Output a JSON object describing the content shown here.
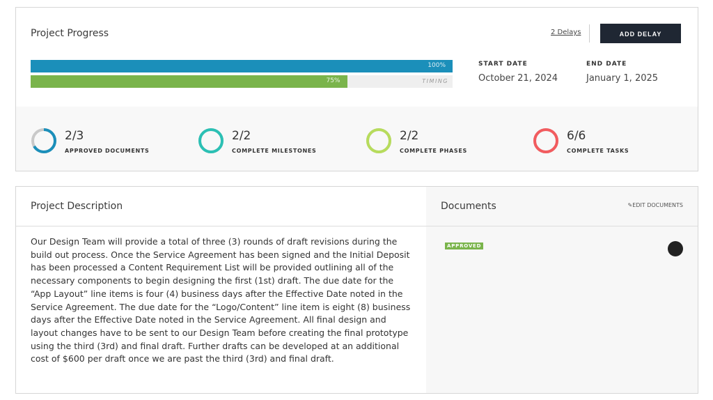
{
  "progress": {
    "title": "Project Progress",
    "delays_link": "2 Delays",
    "add_delay_label": "ADD DELAY",
    "progress_bar": {
      "value": 100,
      "label": "100%",
      "color": "#1b8fba"
    },
    "timing_bar": {
      "value": 75,
      "label": "75%",
      "track_label": "TIMING",
      "color": "#7ab44b"
    },
    "start_date": {
      "label": "START DATE",
      "value": "October 21, 2024"
    },
    "end_date": {
      "label": "END DATE",
      "value": "January 1, 2025"
    },
    "stats": [
      {
        "value": "2/3",
        "label": "APPROVED DOCUMENTS",
        "fraction": 0.667,
        "color": "#1b8fba"
      },
      {
        "value": "2/2",
        "label": "COMPLETE MILESTONES",
        "fraction": 1,
        "color": "#2bc0b4"
      },
      {
        "value": "2/2",
        "label": "COMPLETE PHASES",
        "fraction": 1,
        "color": "#b7dc5c"
      },
      {
        "value": "6/6",
        "label": "COMPLETE TASKS",
        "fraction": 1,
        "color": "#f25c5f"
      }
    ]
  },
  "description": {
    "title": "Project Description",
    "body": "Our Design Team will provide a total of three (3) rounds of draft revisions during the build out process. Once the Service Agreement has been signed and the Initial Deposit has been processed a Content Requirement List will be provided outlining all of the necessary components to begin designing the first (1st) draft. The due date for the “App Layout” line items is four (4) business days after the Effective Date noted in the Service Agreement. The due date for the “Logo/Content” line item is eight (8) business days after the Effective Date noted in the Service Agreement. All final design and layout changes have to be sent to our Design Team before creating the final prototype using the third (3rd) and final draft. Further drafts can be developed at an additional cost of $600 per draft once we are past the third (3rd) and final draft."
  },
  "documents": {
    "title": "Documents",
    "edit_label": "EDIT DOCUMENTS",
    "edit_icon": "pencil-icon",
    "items": [
      {
        "status": "APPROVED"
      }
    ]
  }
}
